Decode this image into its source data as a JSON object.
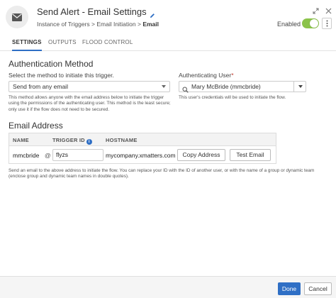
{
  "header": {
    "title": "Send Alert - Email Settings",
    "breadcrumb": "Instance of Triggers > Email Initiation > ",
    "breadcrumb_current": "Email",
    "enabled_label": "Enabled",
    "enabled": true
  },
  "tabs": [
    "SETTINGS",
    "OUTPUTS",
    "FLOOD CONTROL"
  ],
  "auth": {
    "heading": "Authentication Method",
    "method_label": "Select the method to initiate this trigger.",
    "method_value": "Send from any email",
    "method_help": "This method allows anyone with the email address below to initiate the trigger using the permissions of the authenticating user. This method is the least secure; only use it if the flow does not need to be secured.",
    "user_label": "Authenticating User",
    "required_mark": "*",
    "user_value": "Mary McBride (mmcbride)",
    "user_help": "This user's credentials will be used to initiate the flow."
  },
  "email": {
    "heading": "Email Address",
    "columns": [
      "NAME",
      "TRIGGER ID",
      "HOSTNAME"
    ],
    "name": "mmcbride",
    "at": "@",
    "trigger_id": "flyzs",
    "hostname": "mycompany.xmatters.com",
    "copy_label": "Copy Address",
    "test_label": "Test Email",
    "help": "Send an email to the above address to initiate the flow. You can replace your ID with the ID of another user, or with the name of a group or dynamic team (enclose group and dynamic team names in double quotes)."
  },
  "footer": {
    "done_label": "Done",
    "cancel_label": "Cancel"
  },
  "colors": {
    "accent": "#2f6fc5",
    "toggle_on": "#8bc34a"
  }
}
